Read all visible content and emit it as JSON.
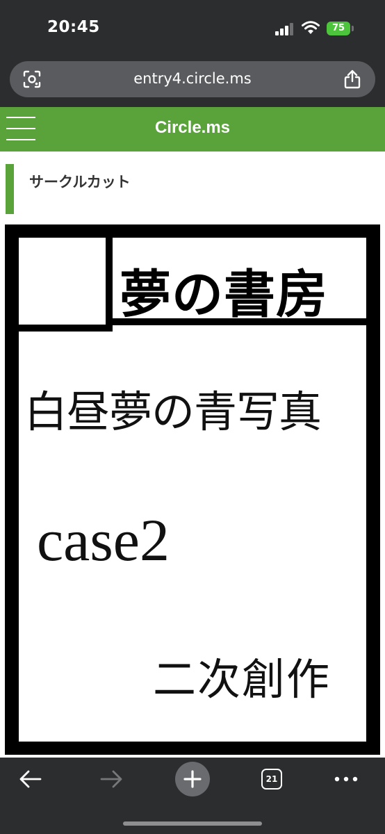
{
  "status_bar": {
    "time": "20:45",
    "battery": "75",
    "icons": [
      "signal-icon",
      "wifi-icon",
      "battery-icon"
    ]
  },
  "browser": {
    "url": "entry4.circle.ms",
    "icons": [
      "lens-icon",
      "share-icon"
    ]
  },
  "site": {
    "logo": "Circle.ms",
    "menu_icon": "hamburger-icon",
    "accent_color": "#5aa33a"
  },
  "section": {
    "title": "サークルカット"
  },
  "circle_cut": {
    "circle_name": "夢の書房",
    "title": "白昼夢の青写真",
    "subtitle": "case2",
    "genre": "二次創作"
  },
  "toolbar": {
    "tab_count": "21",
    "icons": [
      "back-arrow-icon",
      "forward-arrow-icon",
      "plus-icon",
      "tabs-icon",
      "more-icon"
    ]
  }
}
